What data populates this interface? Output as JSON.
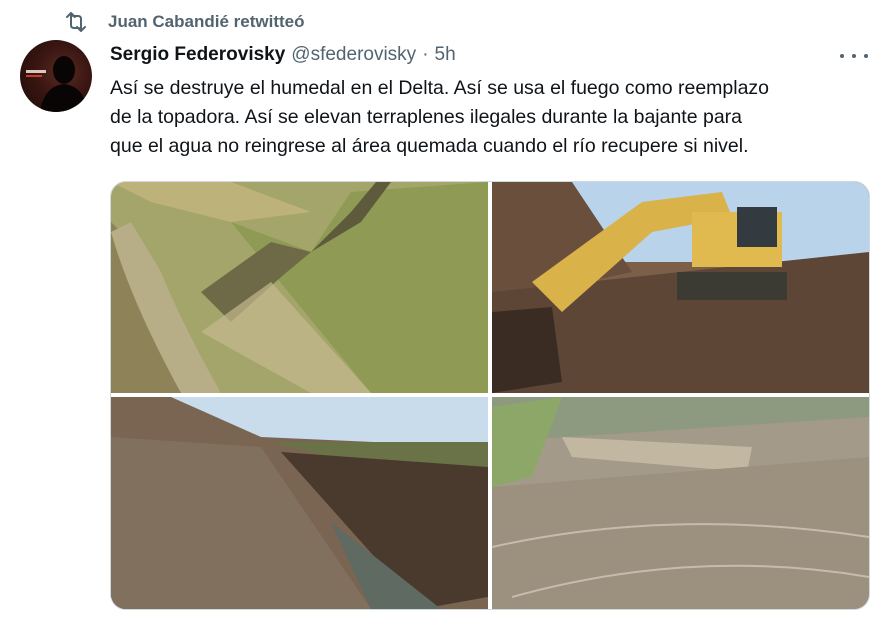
{
  "retweet": {
    "label": "Juan Cabandié retwitteó",
    "icon": "retweet-icon"
  },
  "tweet": {
    "author_name": "Sergio Federovisky",
    "handle": "@sfederovisky",
    "separator": "·",
    "time": "5h",
    "text_lines": [
      "Así se destruye el humedal en el Delta. Así se usa el fuego como reemplazo",
      "de la topadora. Así se elevan terraplenes ilegales durante la bajante para",
      "que el agua no reingrese al área quemada cuando el río recupere si nivel."
    ],
    "more_icon": "more-options-icon"
  },
  "media": {
    "photos": [
      "aerial-embankment-photo",
      "excavator-photo",
      "trench-canal-photo",
      "burned-field-photo"
    ]
  },
  "colors": {
    "text": "#0f1419",
    "secondary": "#536471",
    "border": "#cfd9de"
  }
}
